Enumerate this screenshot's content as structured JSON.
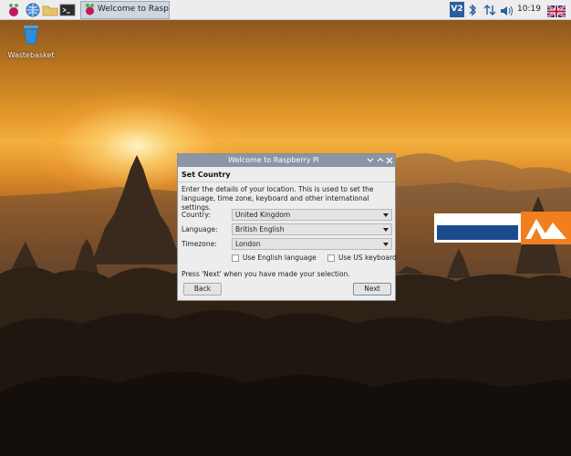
{
  "taskbar": {
    "launchers": [
      {
        "icon": "raspberry-menu-icon"
      },
      {
        "icon": "globe-browser-icon"
      },
      {
        "icon": "folder-icon"
      },
      {
        "icon": "terminal-icon"
      }
    ],
    "window_button": {
      "icon": "raspberry-icon",
      "label": "Welcome to Raspberr..."
    },
    "tray": {
      "vnc_label": "V2",
      "bluetooth_icon": "bluetooth-icon",
      "network_icon": "network-arrows-icon",
      "volume_icon": "volume-icon",
      "clock": "10:19",
      "keyboard_layout_icon": "uk-flag-icon"
    }
  },
  "desktop": {
    "wastebasket_label": "Wastebasket"
  },
  "dialog": {
    "title": "Welcome to Raspberry Pi",
    "heading": "Set Country",
    "description": "Enter the details of your location. This is used to set the language, time zone, keyboard and other international settings.",
    "fields": {
      "country": {
        "label": "Country:",
        "value": "United Kingdom"
      },
      "language": {
        "label": "Language:",
        "value": "British English"
      },
      "timezone": {
        "label": "Timezone:",
        "value": "London"
      }
    },
    "checkboxes": {
      "english_language": {
        "label": "Use English language",
        "checked": false
      },
      "us_keyboard": {
        "label": "Use US keyboard",
        "checked": false
      }
    },
    "hint": "Press 'Next' when you have made your selection.",
    "back_label": "Back",
    "next_label": "Next"
  },
  "colors": {
    "dialog_title_bar": "#8a95a5",
    "taskbar_bg": "#ededed",
    "dialog_bg": "#ededed"
  }
}
